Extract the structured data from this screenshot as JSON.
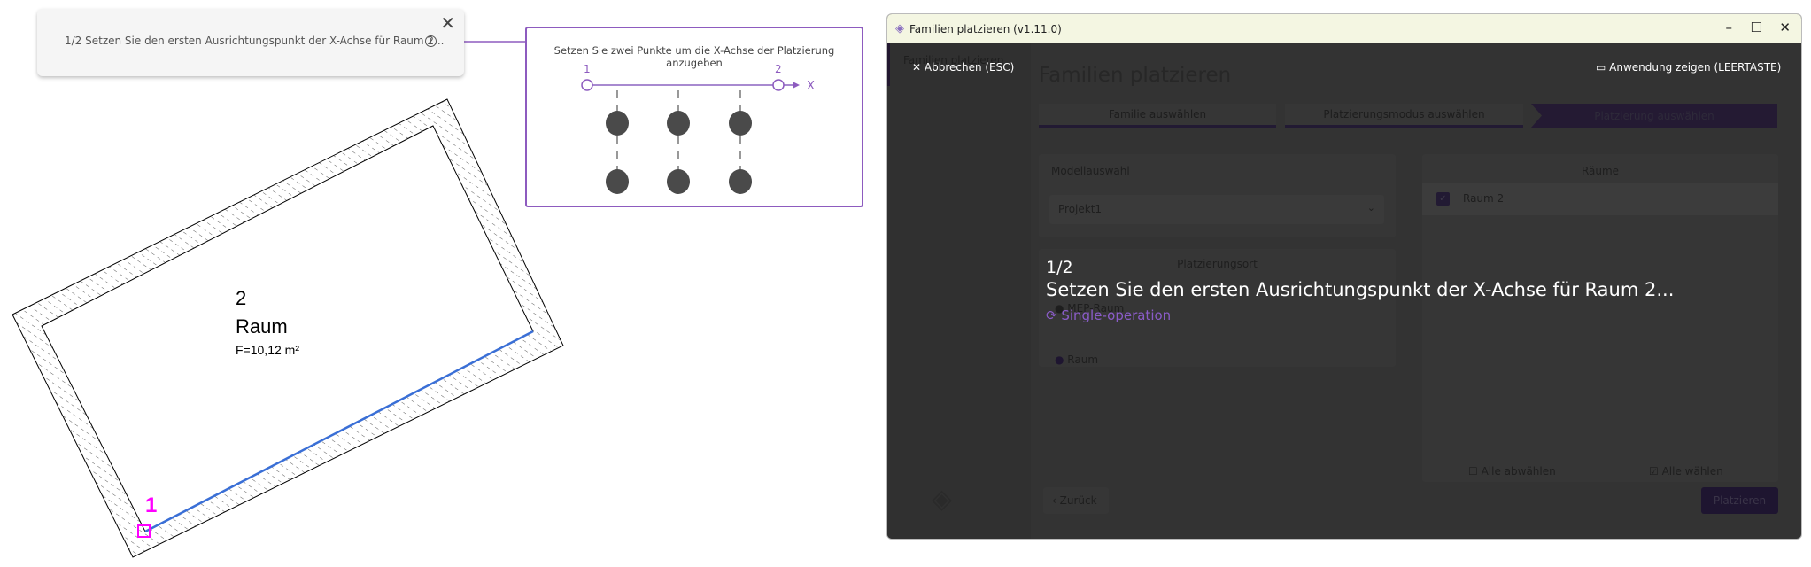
{
  "tooltip_card": {
    "message": "1/2 Setzen Sie den ersten Ausrichtungspunkt der X-Achse für Raum 2...",
    "close_icon": "close-icon",
    "info_icon": "info-icon",
    "info_glyph": "i",
    "close_glyph": "✕"
  },
  "hint_box": {
    "title": "Setzen Sie zwei Punkte um die X-Achse der Platzierung anzugeben",
    "point1": "1",
    "point2": "2",
    "axis_label": "X",
    "accent": "#8d5bbf"
  },
  "drawing": {
    "room_number": "2",
    "room_name": "Raum",
    "room_area": "F=10,12 m²",
    "point_label": "1",
    "marker_color": "#ff00ff",
    "edge_color": "#3a6fd6"
  },
  "window": {
    "title": "Familien platzieren (v1.11.0)",
    "minimize": "–",
    "maximize": "☐",
    "close": "✕",
    "sidebar": {
      "item": "Familien platzieren"
    },
    "cancel": "✕ Abbrechen (ESC)",
    "show_app": "Anwendung zeigen (LEERTASTE)",
    "heading": "Familien platzieren",
    "steps": [
      {
        "label": "Familie auswählen"
      },
      {
        "label": "Platzierungsmodus auswählen"
      },
      {
        "label": "Platzierung auswählen"
      }
    ],
    "model": {
      "label": "Modellauswahl",
      "value": "Projekt1"
    },
    "placement": {
      "label": "Platzierungsort",
      "options": [
        "MEP-Raum",
        "Raum"
      ]
    },
    "rooms": {
      "header": "Räume",
      "items": [
        {
          "label": "Raum 2",
          "checked": true
        }
      ],
      "deselect_all": "Alle abwählen",
      "select_all": "Alle wählen"
    },
    "back": "Zurück",
    "place": "Platzieren",
    "overlay": {
      "step": "1/2",
      "instruction": "Setzen Sie den ersten Ausrichtungspunkt der X-Achse für Raum 2...",
      "mode": "Single-operation",
      "mode_color": "#8a5cc8"
    }
  }
}
